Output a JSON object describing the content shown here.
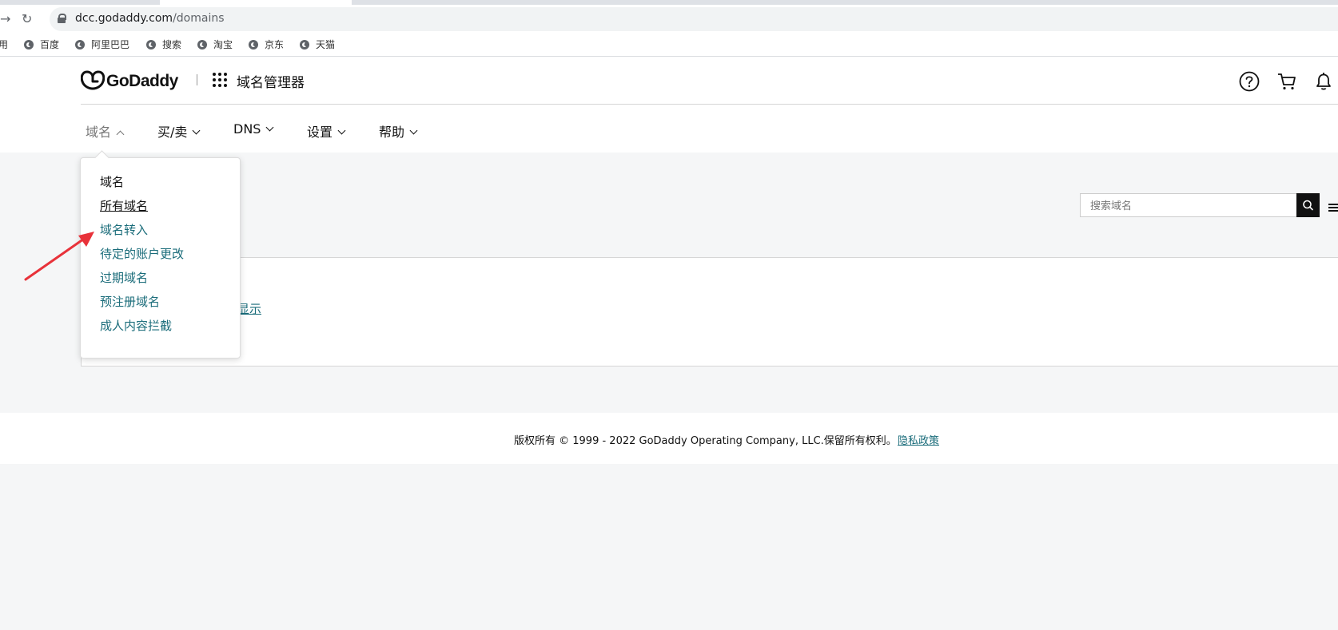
{
  "browser": {
    "url_host": "dcc.godaddy.com",
    "url_path": "/domains",
    "bookmarks": [
      "百度",
      "阿里巴巴",
      "搜索",
      "淘宝",
      "京东",
      "天猫"
    ],
    "bookmark_prefix": "使用"
  },
  "header": {
    "brand": "GoDaddy",
    "product": "域名管理器",
    "icons": [
      "help-icon",
      "cart-icon",
      "bell-icon"
    ]
  },
  "nav": {
    "items": [
      {
        "label": "域名",
        "state": "expanded"
      },
      {
        "label": "买/卖"
      },
      {
        "label": "DNS"
      },
      {
        "label": "设置"
      },
      {
        "label": "帮助"
      }
    ]
  },
  "dropdown": {
    "heading": "域名",
    "items": [
      "所有域名",
      "域名转入",
      "待定的账户更改",
      "过期域名",
      "预注册域名",
      "成人内容拦截"
    ]
  },
  "main": {
    "search_placeholder": "搜索域名",
    "partial_link": "显示"
  },
  "footer": {
    "copyright": "版权所有 © 1999 - 2022 GoDaddy Operating Company, LLC.保留所有权利。",
    "privacy_link": "隐私政策"
  },
  "colors": {
    "link": "#1a6c7a",
    "annotation_arrow": "#e8323a",
    "page_bg": "#f5f6f7"
  }
}
